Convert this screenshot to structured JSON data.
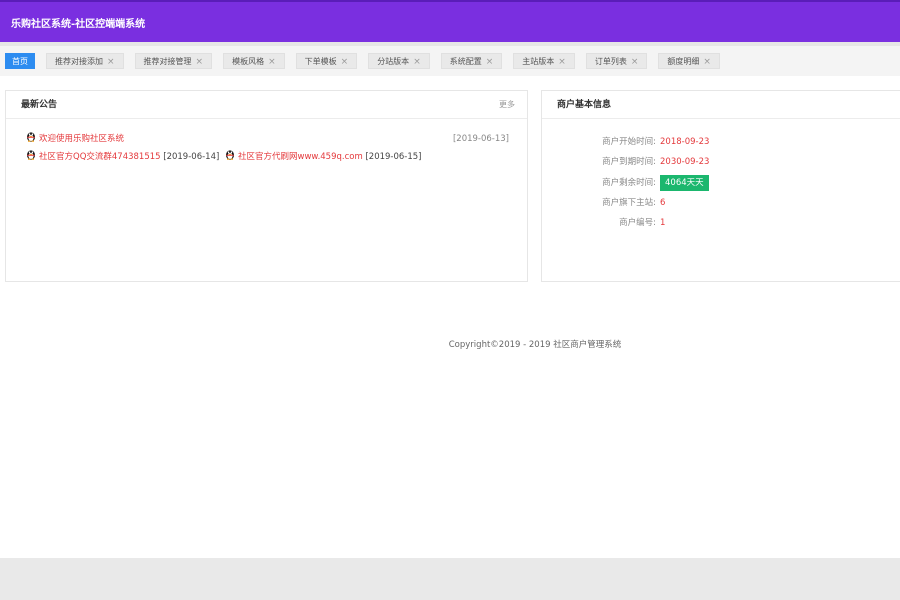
{
  "header": {
    "title": "乐购社区系统-社区控端端系统"
  },
  "tabs": [
    {
      "label": "首页",
      "active": true,
      "closable": false
    },
    {
      "label": "推荐对接添加",
      "closable": true
    },
    {
      "label": "推荐对接管理",
      "closable": true
    },
    {
      "label": "模板风格",
      "closable": true
    },
    {
      "label": "下单模板",
      "closable": true
    },
    {
      "label": "分站版本",
      "closable": true
    },
    {
      "label": "系统配置",
      "closable": true
    },
    {
      "label": "主站版本",
      "closable": true
    },
    {
      "label": "订单列表",
      "closable": true
    },
    {
      "label": "额度明细",
      "closable": true
    }
  ],
  "tab_close_glyph": "×",
  "announcements": {
    "title": "最新公告",
    "more": "更多",
    "items": [
      {
        "text": "欢迎使用乐购社区系统",
        "date": "[2019-06-13]"
      },
      {
        "text": "社区官方QQ交流群474381515",
        "date": "[2019-06-14]"
      },
      {
        "text": "社区官方代刷网www.459q.com",
        "date": "[2019-06-15]"
      }
    ]
  },
  "merchant": {
    "title": "商户基本信息",
    "rows": [
      {
        "label": "商户开始时间:",
        "value": "2018-09-23"
      },
      {
        "label": "商户到期时间:",
        "value": "2030-09-23"
      },
      {
        "label": "商户剩余时间:",
        "value": "4064天天",
        "badge": true
      },
      {
        "label": "商户旗下主站:",
        "value": "6"
      },
      {
        "label": "商户编号:",
        "value": "1"
      }
    ]
  },
  "footer": {
    "text": "Copyright©2019 - 2019 社区商户管理系统"
  },
  "colors": {
    "topbar": "#7a2fe0",
    "active_tab": "#2d8cf0",
    "link_red": "#e4393c",
    "badge_green": "#1bb76e"
  },
  "icons": {
    "announcement_bullet": "qq-penguin-icon",
    "tab_close": "close-icon"
  }
}
